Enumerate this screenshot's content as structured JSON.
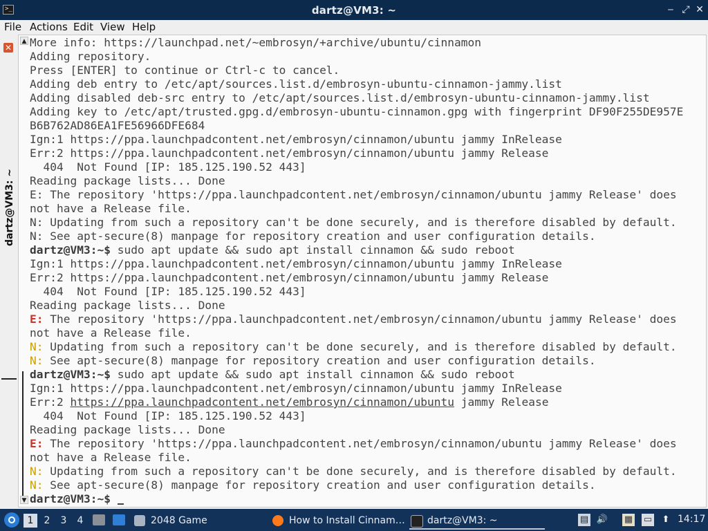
{
  "window": {
    "title": "dartz@VM3: ~",
    "app_icon": ">_",
    "minimize": "‒",
    "maximize": "⤢",
    "close": "✕"
  },
  "menu": [
    "File",
    "Actions",
    "Edit",
    "View",
    "Help"
  ],
  "side_tab": {
    "label": "dartz@VM3: ~",
    "close_glyph": "✕"
  },
  "terminal": {
    "lines": [
      {
        "t": "More info: https://launchpad.net/~embrosyn/+archive/ubuntu/cinnamon"
      },
      {
        "t": "Adding repository."
      },
      {
        "t": "Press [ENTER] to continue or Ctrl-c to cancel."
      },
      {
        "t": "Adding deb entry to /etc/apt/sources.list.d/embrosyn-ubuntu-cinnamon-jammy.list"
      },
      {
        "t": "Adding disabled deb-src entry to /etc/apt/sources.list.d/embrosyn-ubuntu-cinnamon-jammy.list"
      },
      {
        "t": "Adding key to /etc/apt/trusted.gpg.d/embrosyn-ubuntu-cinnamon.gpg with fingerprint DF90F255DE957E"
      },
      {
        "t": "B6B762AD86EA1FE56966DFE684"
      },
      {
        "t": "Ign:1 https://ppa.launchpadcontent.net/embrosyn/cinnamon/ubuntu jammy InRelease"
      },
      {
        "t": "Err:2 https://ppa.launchpadcontent.net/embrosyn/cinnamon/ubuntu jammy Release"
      },
      {
        "t": "  404  Not Found [IP: 185.125.190.52 443]"
      },
      {
        "t": "Reading package lists... Done"
      },
      {
        "t": "E: The repository 'https://ppa.launchpadcontent.net/embrosyn/cinnamon/ubuntu jammy Release' does"
      },
      {
        "t": "not have a Release file."
      },
      {
        "t": "N: Updating from such a repository can't be done securely, and is therefore disabled by default."
      },
      {
        "t": "N: See apt-secure(8) manpage for repository creation and user configuration details."
      },
      {
        "prompt": "dartz@VM3:~$",
        "t": " sudo apt update && sudo apt install cinnamon && sudo reboot"
      },
      {
        "t": "Ign:1 https://ppa.launchpadcontent.net/embrosyn/cinnamon/ubuntu jammy InRelease"
      },
      {
        "t": "Err:2 https://ppa.launchpadcontent.net/embrosyn/cinnamon/ubuntu jammy Release"
      },
      {
        "t": "  404  Not Found [IP: 185.125.190.52 443]"
      },
      {
        "t": "Reading package lists... Done"
      },
      {
        "pfx": "E:",
        "cls": "err",
        "t": " The repository 'https://ppa.launchpadcontent.net/embrosyn/cinnamon/ubuntu jammy Release' does"
      },
      {
        "t": "not have a Release file."
      },
      {
        "pfx": "N:",
        "cls": "note",
        "t": " Updating from such a repository can't be done securely, and is therefore disabled by default."
      },
      {
        "pfx": "N:",
        "cls": "note",
        "t": " See apt-secure(8) manpage for repository creation and user configuration details."
      },
      {
        "prompt": "dartz@VM3:~$",
        "t": " sudo apt update && sudo apt install cinnamon && sudo reboot"
      },
      {
        "t": "Ign:1 https://ppa.launchpadcontent.net/embrosyn/cinnamon/ubuntu jammy InRelease"
      },
      {
        "pre": "Err:2 ",
        "link": "https://ppa.launchpadcontent.net/embrosyn/cinnamon/ubuntu",
        "t": " jammy Release"
      },
      {
        "t": "  404  Not Found [IP: 185.125.190.52 443]"
      },
      {
        "t": "Reading package lists... Done"
      },
      {
        "pfx": "E:",
        "cls": "err",
        "t": " The repository 'https://ppa.launchpadcontent.net/embrosyn/cinnamon/ubuntu jammy Release' does"
      },
      {
        "t": "not have a Release file."
      },
      {
        "pfx": "N:",
        "cls": "note",
        "t": " Updating from such a repository can't be done securely, and is therefore disabled by default."
      },
      {
        "pfx": "N:",
        "cls": "note",
        "t": " See apt-secure(8) manpage for repository creation and user configuration details."
      },
      {
        "prompt": "dartz@VM3:~$",
        "t": " ",
        "cursor": true
      }
    ]
  },
  "taskbar": {
    "workspaces": [
      "1",
      "2",
      "3",
      "4"
    ],
    "active_workspace": "1",
    "tasks": [
      {
        "label": "2048 Game",
        "icon": "window-icon"
      },
      {
        "label": "How to Install Cinnam…",
        "icon": "firefox-icon"
      },
      {
        "label": "dartz@VM3: ~",
        "icon": "terminal-icon"
      }
    ],
    "clock": "14:17"
  },
  "colors": {
    "titlebar": "#0c2a4c",
    "taskbar": "#12325a",
    "error_prefix": "#c0392b",
    "note_prefix": "#c9a000"
  }
}
